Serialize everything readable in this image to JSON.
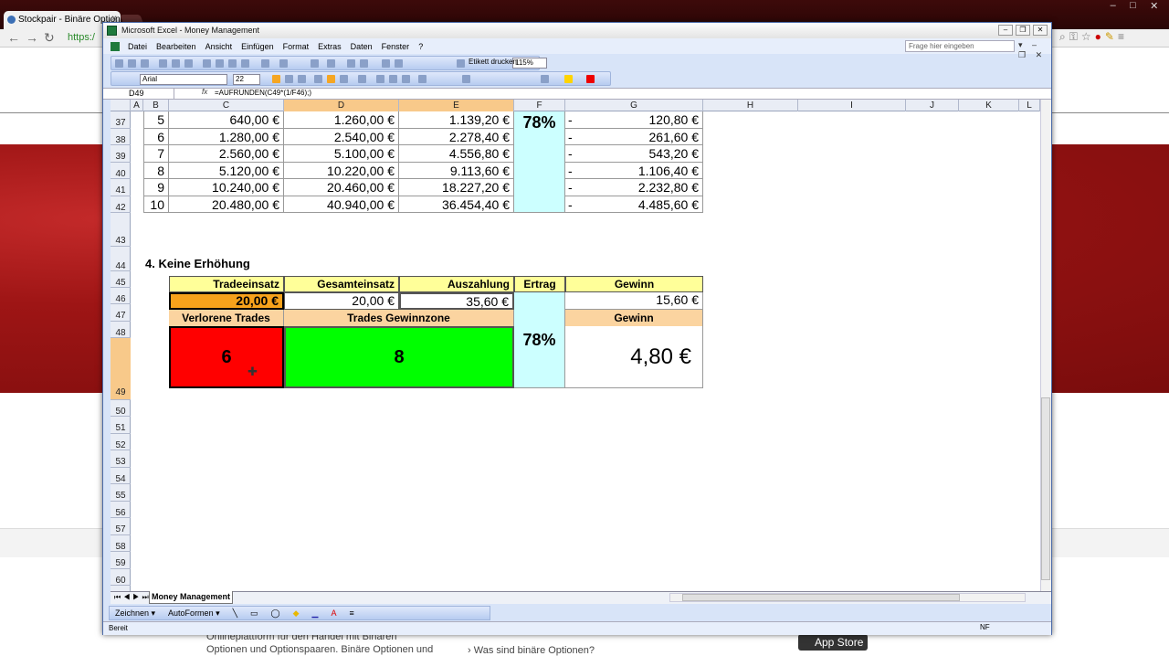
{
  "browser": {
    "tab_title": "Stockpair - Binäre Option",
    "url_prefix": "https:/",
    "window_controls": [
      "–",
      "□",
      "✕"
    ]
  },
  "webpage": {
    "text_line1": "Onlineplattform für den Handel mit Binären",
    "text_line2": "Optionen und Optionspaaren. Binäre Optionen und",
    "link": "Was sind binäre Optionen?",
    "appstore": "App Store"
  },
  "excel": {
    "title": "Microsoft Excel - Money Management",
    "menu": [
      "Datei",
      "Bearbeiten",
      "Ansicht",
      "Einfügen",
      "Format",
      "Extras",
      "Daten",
      "Fenster",
      "?"
    ],
    "ask_placeholder": "Frage hier eingeben",
    "zoom": "115%",
    "etikett": "Etikett drucken",
    "font": "Arial",
    "font_size": "22",
    "namebox": "D49",
    "fx": "fx",
    "formula": "=AUFRUNDEN(C49*(1/F46);)",
    "columns": [
      "A",
      "B",
      "C",
      "D",
      "E",
      "F",
      "G",
      "H",
      "I",
      "J",
      "K",
      "L"
    ],
    "rows": [
      "37",
      "38",
      "39",
      "40",
      "41",
      "42",
      "43",
      "44",
      "45",
      "46",
      "47",
      "48",
      "49",
      "50",
      "51",
      "52",
      "53",
      "54",
      "55",
      "56",
      "57",
      "58",
      "59",
      "60"
    ],
    "table_top": [
      {
        "b": "5",
        "c": "640,00 €",
        "d": "1.260,00 €",
        "e": "1.139,20 €",
        "g_sign": "-",
        "g": "120,80 €"
      },
      {
        "b": "6",
        "c": "1.280,00 €",
        "d": "2.540,00 €",
        "e": "2.278,40 €",
        "g_sign": "-",
        "g": "261,60 €"
      },
      {
        "b": "7",
        "c": "2.560,00 €",
        "d": "5.100,00 €",
        "e": "4.556,80 €",
        "g_sign": "-",
        "g": "543,20 €"
      },
      {
        "b": "8",
        "c": "5.120,00 €",
        "d": "10.220,00 €",
        "e": "9.113,60 €",
        "g_sign": "-",
        "g": "1.106,40 €"
      },
      {
        "b": "9",
        "c": "10.240,00 €",
        "d": "20.460,00 €",
        "e": "18.227,20 €",
        "g_sign": "-",
        "g": "2.232,80 €"
      },
      {
        "b": "10",
        "c": "20.480,00 €",
        "d": "40.940,00 €",
        "e": "36.454,40 €",
        "g_sign": "-",
        "g": "4.485,60 €"
      }
    ],
    "top_ertrag": "78%",
    "section_title": "4. Keine Erhöhung",
    "headers1": {
      "c": "Tradeeinsatz",
      "d": "Gesamteinsatz",
      "e": "Auszahlung",
      "f": "Ertrag",
      "g": "Gewinn"
    },
    "row46": {
      "c": "20,00 €",
      "d": "20,00 €",
      "e": "35,60 €",
      "g": "15,60 €"
    },
    "headers2": {
      "c": "Verlorene Trades",
      "de": "Trades Gewinnzone",
      "g": "Gewinn"
    },
    "row49": {
      "c": "6",
      "de": "8",
      "f": "78%",
      "g": "4,80 €"
    },
    "sheet_tab": "Money Management",
    "draw_menu": "Zeichnen ▾",
    "autoformen": "AutoFormen ▾",
    "status": "Bereit",
    "nf": "NF",
    "colors": {
      "orange": "#f7a21b",
      "red": "#ff0000",
      "green": "#00ff00",
      "yellow": "#ffff99",
      "peach": "#fbd4a0",
      "cyan": "#ccffff",
      "selected_header": "#f8c98a"
    }
  }
}
